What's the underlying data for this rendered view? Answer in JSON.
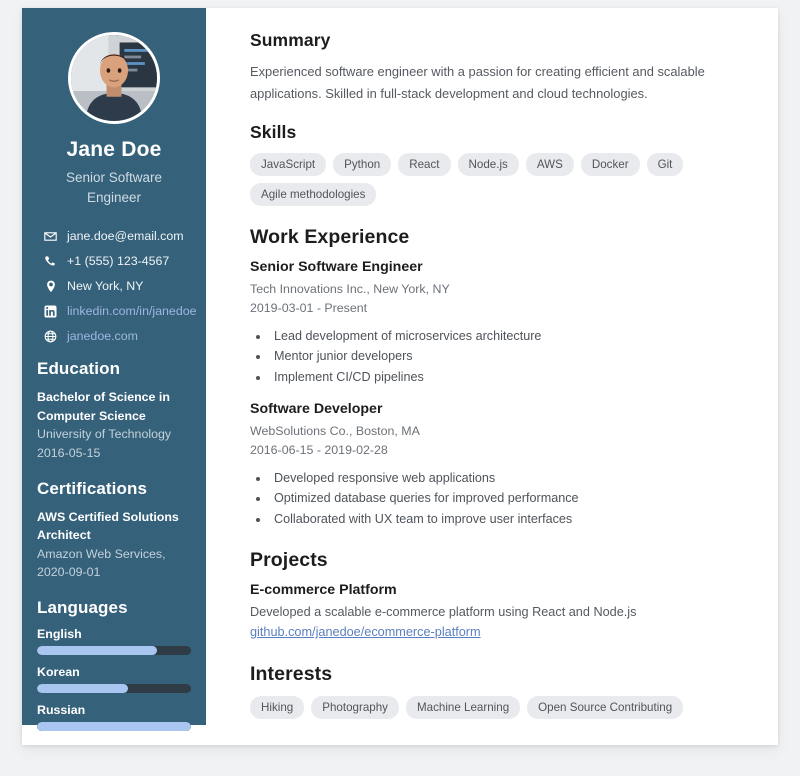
{
  "theme": {
    "sidebar_bg": "#35617a",
    "card_bg": "#ffffff",
    "page_bg": "#f1f2f4",
    "accent_link": "#5b7fc0",
    "sidebar_link": "#9fb6e0",
    "lang_fill": "#a8c6f0",
    "lang_track": "#2f3b45",
    "tag_bg": "#e9eaee"
  },
  "sidebar": {
    "avatar_icon": "profile-photo",
    "name": "Jane Doe",
    "title": "Senior Software Engineer",
    "contacts": [
      {
        "icon": "envelope-icon",
        "text": "jane.doe@email.com",
        "is_link": false
      },
      {
        "icon": "phone-icon",
        "text": "+1 (555) 123-4567",
        "is_link": false
      },
      {
        "icon": "map-pin-icon",
        "text": "New York, NY",
        "is_link": false
      },
      {
        "icon": "linkedin-icon",
        "text": "linkedin.com/in/janedoe",
        "is_link": true
      },
      {
        "icon": "globe-icon",
        "text": "janedoe.com",
        "is_link": true
      }
    ],
    "education": {
      "heading": "Education",
      "degree": "Bachelor of Science in Computer Science",
      "school": "University of Technology",
      "date": "2016-05-15"
    },
    "certifications": {
      "heading": "Certifications",
      "name": "AWS Certified Solutions Architect",
      "issuer_and_date": "Amazon Web Services, 2020-09-01"
    },
    "languages": {
      "heading": "Languages",
      "items": [
        {
          "name": "English",
          "level_percent": 78
        },
        {
          "name": "Korean",
          "level_percent": 59
        },
        {
          "name": "Russian",
          "level_percent": 100
        }
      ]
    }
  },
  "main": {
    "summary": {
      "heading": "Summary",
      "text": "Experienced software engineer with a passion for creating efficient and scalable applications. Skilled in full-stack development and cloud technologies."
    },
    "skills": {
      "heading": "Skills",
      "items": [
        "JavaScript",
        "Python",
        "React",
        "Node.js",
        "AWS",
        "Docker",
        "Git",
        "Agile methodologies"
      ]
    },
    "work_experience": {
      "heading": "Work Experience",
      "jobs": [
        {
          "title": "Senior Software Engineer",
          "company": "Tech Innovations Inc., New York, NY",
          "dates": "2019-03-01 - Present",
          "bullets": [
            "Lead development of microservices architecture",
            "Mentor junior developers",
            "Implement CI/CD pipelines"
          ]
        },
        {
          "title": "Software Developer",
          "company": "WebSolutions Co., Boston, MA",
          "dates": "2016-06-15 - 2019-02-28",
          "bullets": [
            "Developed responsive web applications",
            "Optimized database queries for improved performance",
            "Collaborated with UX team to improve user interfaces"
          ]
        }
      ]
    },
    "projects": {
      "heading": "Projects",
      "items": [
        {
          "title": "E-commerce Platform",
          "description": "Developed a scalable e-commerce platform using React and Node.js",
          "link": "github.com/janedoe/ecommerce-platform"
        }
      ]
    },
    "interests": {
      "heading": "Interests",
      "items": [
        "Hiking",
        "Photography",
        "Machine Learning",
        "Open Source Contributing"
      ]
    }
  }
}
